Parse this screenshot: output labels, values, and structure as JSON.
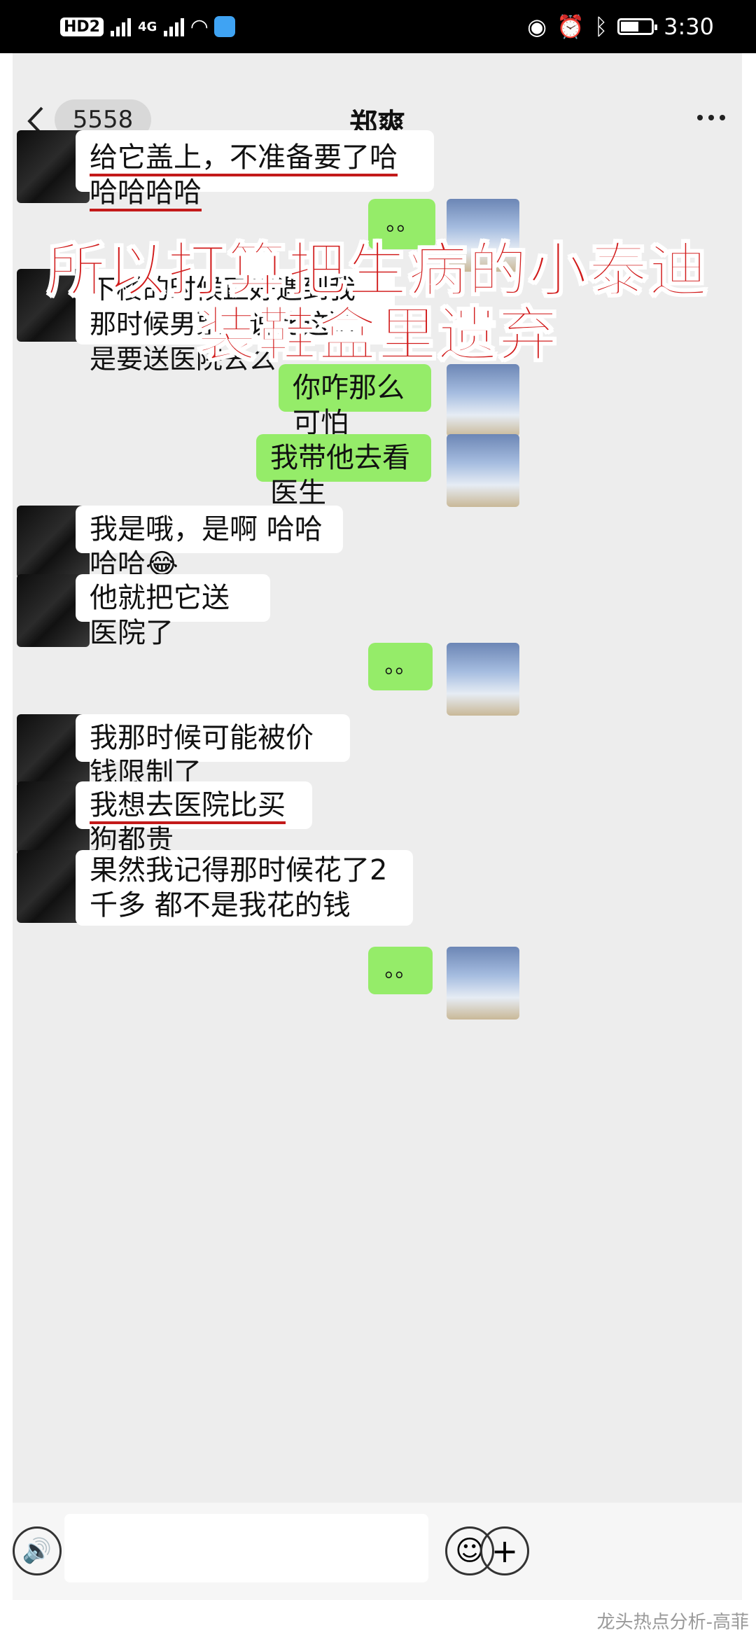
{
  "status_bar": {
    "left": [
      "HD2",
      "4G"
    ],
    "time": "3:30"
  },
  "header": {
    "back_count": "5558",
    "title": "郑爽"
  },
  "overlay": {
    "line1": "所以打算把生病的小泰迪",
    "line2": "装鞋盒里遗弃"
  },
  "messages": [
    {
      "side": "in",
      "text": "给它盖上，不准备要了哈哈哈哈哈",
      "underline": true
    },
    {
      "side": "out",
      "text": "。。"
    },
    {
      "side": "in",
      "text": "下楼的时候正好遇到我那时候男票，说比这狗是要送医院去么"
    },
    {
      "side": "out",
      "text": "你咋那么可怕"
    },
    {
      "side": "out",
      "text": "我带他去看医生"
    },
    {
      "side": "in",
      "text": "我是哦，是啊 哈哈哈哈😂"
    },
    {
      "side": "in",
      "text": "他就把它送医院了"
    },
    {
      "side": "out",
      "text": "。。"
    },
    {
      "side": "in",
      "text": "我那时候可能被价钱限制了"
    },
    {
      "side": "in",
      "text": "我想去医院比买狗都贵",
      "underline": true
    },
    {
      "side": "in",
      "text": "果然我记得那时候花了2千多 都不是我花的钱"
    },
    {
      "side": "out",
      "text": "。。"
    }
  ],
  "watermark": "龙头热点分析-高菲",
  "colors": {
    "out_bubble": "#95ec69",
    "in_bubble": "#ffffff",
    "overlay_red": "#d11a1a"
  }
}
